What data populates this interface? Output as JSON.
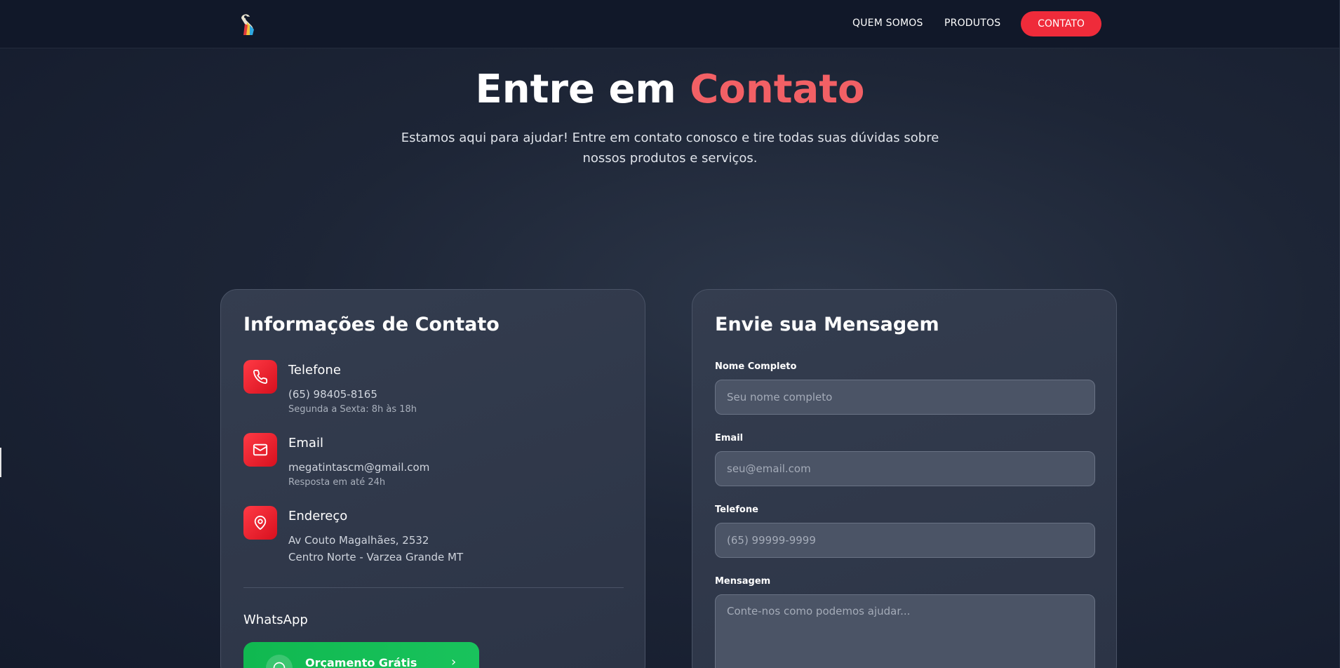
{
  "header": {
    "nav": [
      {
        "label": "QUEM SOMOS"
      },
      {
        "label": "PRODUTOS"
      }
    ],
    "cta_label": "CONTATO"
  },
  "hero": {
    "title_main": "Entre em",
    "title_accent": "Contato",
    "subtitle": "Estamos aqui para ajudar! Entre em contato conosco e tire todas suas dúvidas sobre nossos produtos e serviços."
  },
  "info": {
    "title": "Informações de Contato",
    "items": [
      {
        "icon": "phone-icon",
        "title": "Telefone",
        "line": "(65) 98405-8165",
        "small": "Segunda a Sexta: 8h às 18h"
      },
      {
        "icon": "mail-icon",
        "title": "Email",
        "line": "megatintascm@gmail.com",
        "small": "Resposta em até 24h"
      },
      {
        "icon": "map-pin-icon",
        "title": "Endereço",
        "line": "Av Couto Magalhães, 2532",
        "line2": "Centro Norte - Varzea Grande MT"
      }
    ],
    "whatsapp_label": "WhatsApp",
    "whatsapp_button": "Orçamento Grátis"
  },
  "form": {
    "title": "Envie sua Mensagem",
    "fields": [
      {
        "label": "Nome Completo",
        "placeholder": "Seu nome completo"
      },
      {
        "label": "Email",
        "placeholder": "seu@email.com"
      },
      {
        "label": "Telefone",
        "placeholder": "(65) 99999-9999"
      },
      {
        "label": "Mensagem",
        "placeholder": "Conte-nos como podemos ajudar..."
      }
    ]
  },
  "colors": {
    "accent": "#ef2b3a",
    "title_accent": "#f26065",
    "whatsapp": "#19c35c",
    "background": "#1d2536"
  }
}
